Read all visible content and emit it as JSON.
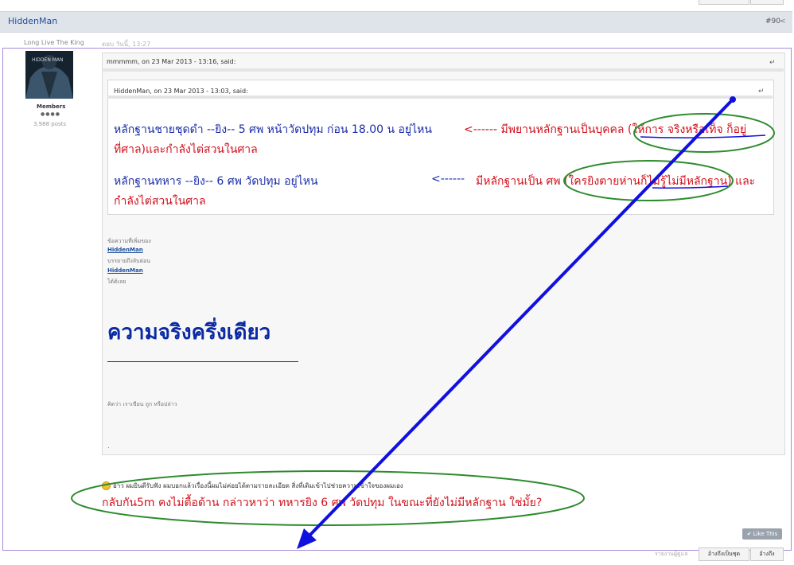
{
  "post": {
    "author": "HiddenMan",
    "number": "#90",
    "user_title": "Long Live The King",
    "date": "ตอบ วันนี้, 13:27",
    "member_group": "Members",
    "rep_dots": "●●●●",
    "post_count": "3,988 posts"
  },
  "outer_quote": {
    "cite": "mmmmm, on 23 Mar 2013 - 13:16, said:"
  },
  "inner_quote": {
    "cite": "HiddenMan, on 23 Mar 2013 - 13:03, said:",
    "line1_blue": "หลักฐานชายชุดดำ --ยิง--  5 ศพ หน้าวัดปทุม ก่อน 18.00 น อยู่ไหน",
    "line1_red": "<------ มีพยานหลักฐานเป็นบุคคล (ให้การ จริงหรือเท็จ ก็อยู่",
    "line2_red": "ที่ศาล)และกำลังไต่สวนในศาล",
    "line3_blue": "หลักฐานทหาร      --ยิง--  6 ศพ วัดปทุม อยู่ไหน",
    "line3_arrow": "<------",
    "line3_red": "มีหลักฐานเป็น ศพ (ใครยิงตายห่านก็ไม่รู้ไม่มีหลักฐาน) และ",
    "line4_red": "กำลังไต่สวนในศาล"
  },
  "signature": {
    "small1": "ข้อความที่เพิ่มของ",
    "link1": "HiddenMan",
    "small2": "บรรยายถึงลับต่อน",
    "link2": "HiddenMan",
    "small3": "ได้ด้เลย",
    "big": "ความจริงครึ่งเดียว",
    "quote": "คิดว่า เราเขียน ถูก หรือปล่าว",
    "dot": "."
  },
  "reply": {
    "smile_line": "อ้าว ผมยินดีรับฟัง ผมบอกแล้วเรื่องนี้ผมไม่ค่อยได้ตามรายละเอียด สิ่งที่เติมเข้าไปช่วยความเข้าใจของผมเอง",
    "red_line": "กลับกัน5m คงไม่ตื้อด้าน กล่าวหาว่า ทหารยิง 6 ศพ วัดปทุม ในขณะที่ยังไม่มีหลักฐาน ใช่มั้ย?"
  },
  "buttons": {
    "like": "✔ Like This",
    "multiquote": "อ้างถึงเป็นชุด",
    "quote": "อ้างถึง"
  },
  "footer_note": "รายงานผู้ดูแล",
  "colors": {
    "annotation_ellipse": "#2e8b2e",
    "annotation_arrow": "#1010e0",
    "text_blue": "#1b2ea8",
    "text_red": "#d1121e",
    "frame": "#a78bdc"
  },
  "icons": {
    "reply_quote": "reply-arrow-icon",
    "share": "share-icon",
    "smile": "smile-icon"
  }
}
